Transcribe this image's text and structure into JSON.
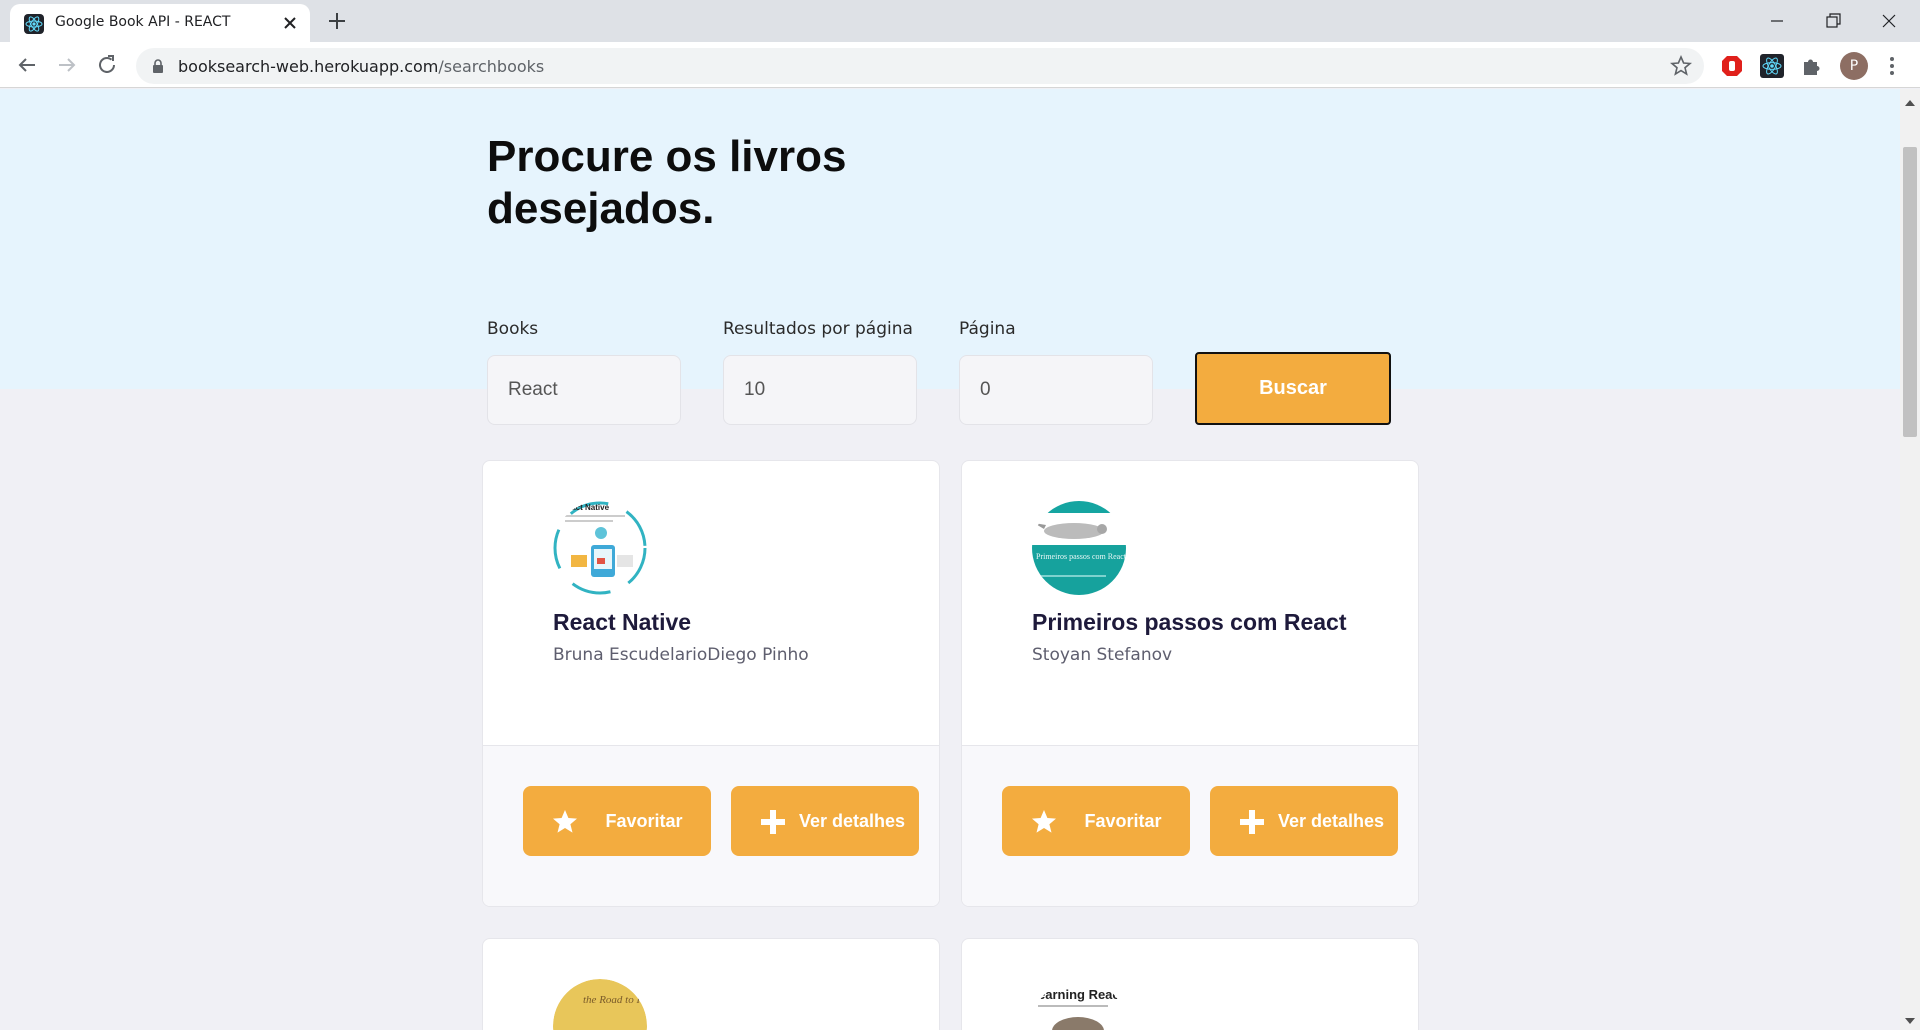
{
  "browser": {
    "tab_title": "Google Book API - REACT",
    "url_host": "booksearch-web.herokuapp.com",
    "url_path": "/searchbooks",
    "avatar_initial": "P"
  },
  "page": {
    "title": "Procure os livros desejados.",
    "fields": {
      "books": {
        "label": "Books",
        "value": "React"
      },
      "per_page": {
        "label": "Resultados por página",
        "value": "10"
      },
      "page": {
        "label": "Página",
        "value": "0"
      }
    },
    "search_button": "Buscar"
  },
  "results": [
    {
      "title": "React Native",
      "authors": "Bruna EscudelarioDiego Pinho",
      "cover_text": "React Native",
      "favorite_label": "Favoritar",
      "details_label": "Ver detalhes"
    },
    {
      "title": "Primeiros passos com React",
      "authors": "Stoyan Stefanov",
      "cover_text": "Primeiros passos com React",
      "favorite_label": "Favoritar",
      "details_label": "Ver detalhes"
    },
    {
      "cover_text": "the Road to React"
    },
    {
      "cover_text": "earning React"
    }
  ],
  "colors": {
    "accent": "#f3ac3f",
    "hero_bg": "#e6f4fd",
    "page_bg": "#f0f0f5",
    "title_text": "#1e1a3b"
  }
}
